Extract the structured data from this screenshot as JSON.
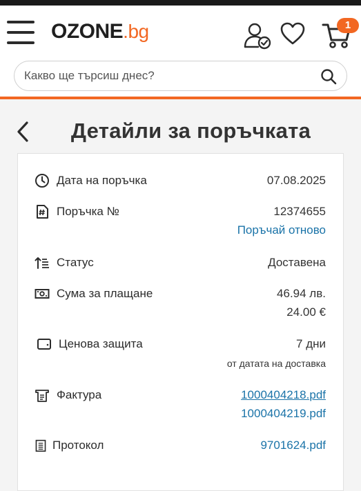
{
  "header": {
    "logo_main": "OZONE",
    "logo_suffix": ".bg",
    "cart_count": "1",
    "icons": [
      "menu-icon",
      "user-check-icon",
      "heart-icon",
      "cart-icon"
    ],
    "accent_color": "#f26722"
  },
  "search": {
    "placeholder": "Какво ще търсиш днес?",
    "value": ""
  },
  "page": {
    "title": "Детайли за поръчката"
  },
  "details": {
    "order_date": {
      "label": "Дата на поръчка",
      "value": "07.08.2025"
    },
    "order_no": {
      "label": "Поръчка №",
      "value": "12374655",
      "reorder": "Поръчай отново"
    },
    "status": {
      "label": "Статус",
      "value": "Доставена"
    },
    "amount": {
      "label": "Сума за плащане",
      "value_bgn": "46.94 лв.",
      "value_eur": "24.00 €"
    },
    "price_protection": {
      "label": "Ценова защита",
      "value": "7 дни",
      "note": "от датата на доставка"
    },
    "invoice": {
      "label": "Фактура",
      "files": [
        "1000404218.pdf",
        "1000404219.pdf"
      ]
    },
    "protocol": {
      "label": "Протокол",
      "file": "9701624.pdf"
    }
  }
}
